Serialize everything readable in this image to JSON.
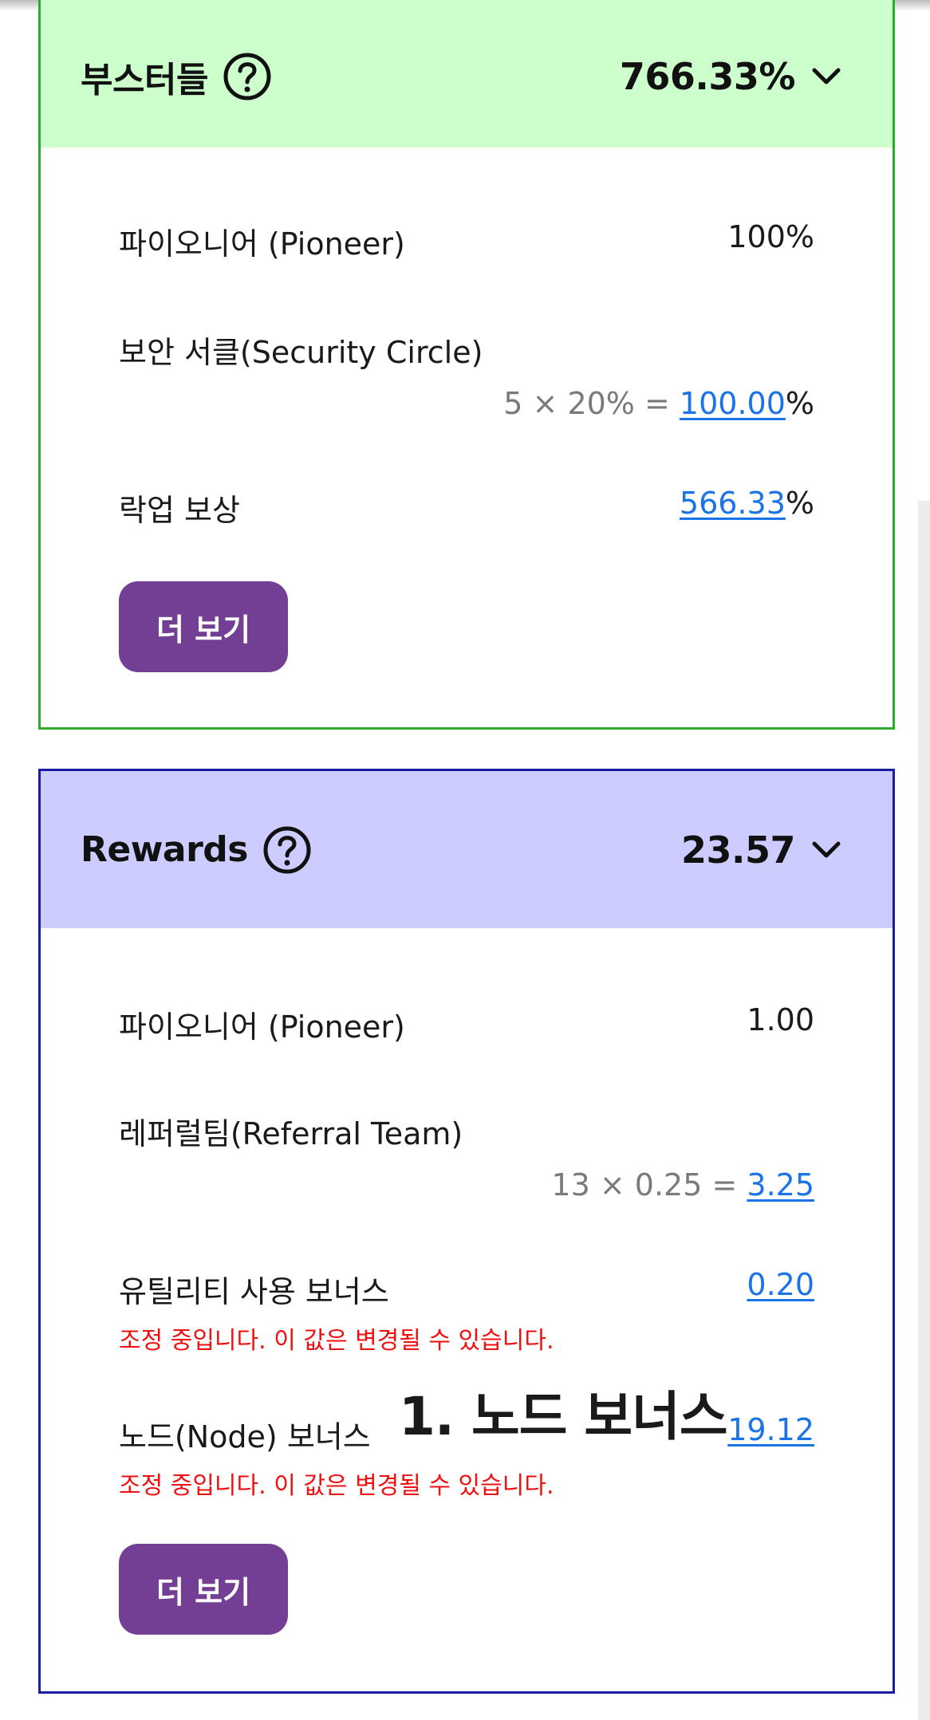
{
  "boosters": {
    "title": "부스터들",
    "total": "766.33%",
    "help_icon": "question-circle-icon",
    "expand_icon": "chevron-down-icon",
    "header_color": "#ccffcc",
    "border_color": "#2eab2e",
    "pioneer_label": "파이오니어 (Pioneer)",
    "pioneer_value": "100%",
    "security_label": "보안 서클(Security Circle)",
    "security_calc": "5 × 20% = ",
    "security_value": "100.00",
    "security_unit": "%",
    "lockup_label": "락업 보상",
    "lockup_value": "566.33",
    "lockup_unit": "%",
    "more_label": "더 보기"
  },
  "rewards": {
    "title": "Rewards",
    "total": "23.57",
    "help_icon": "question-circle-icon",
    "expand_icon": "chevron-down-icon",
    "header_color": "#ccccff",
    "border_color": "#1c1ca3",
    "pioneer_label": "파이오니어 (Pioneer)",
    "pioneer_value": "1.00",
    "referral_label": "레퍼럴팀(Referral Team)",
    "referral_calc": "13 × 0.25 = ",
    "referral_value": "3.25",
    "utility_label": "유틸리티 사용 보너스",
    "utility_value": "0.20",
    "utility_warning": "조정 중입니다. 이 값은 변경될 수 있습니다.",
    "node_label": "노드(Node) 보너스",
    "node_value": "19.12",
    "node_warning": "조정 중입니다. 이 값은 변경될 수 있습니다.",
    "more_label": "더 보기"
  },
  "overlay_caption": "1. 노드 보너스",
  "colors": {
    "button": "#733f94",
    "link": "#1a73e8",
    "warning": "#f01010"
  }
}
